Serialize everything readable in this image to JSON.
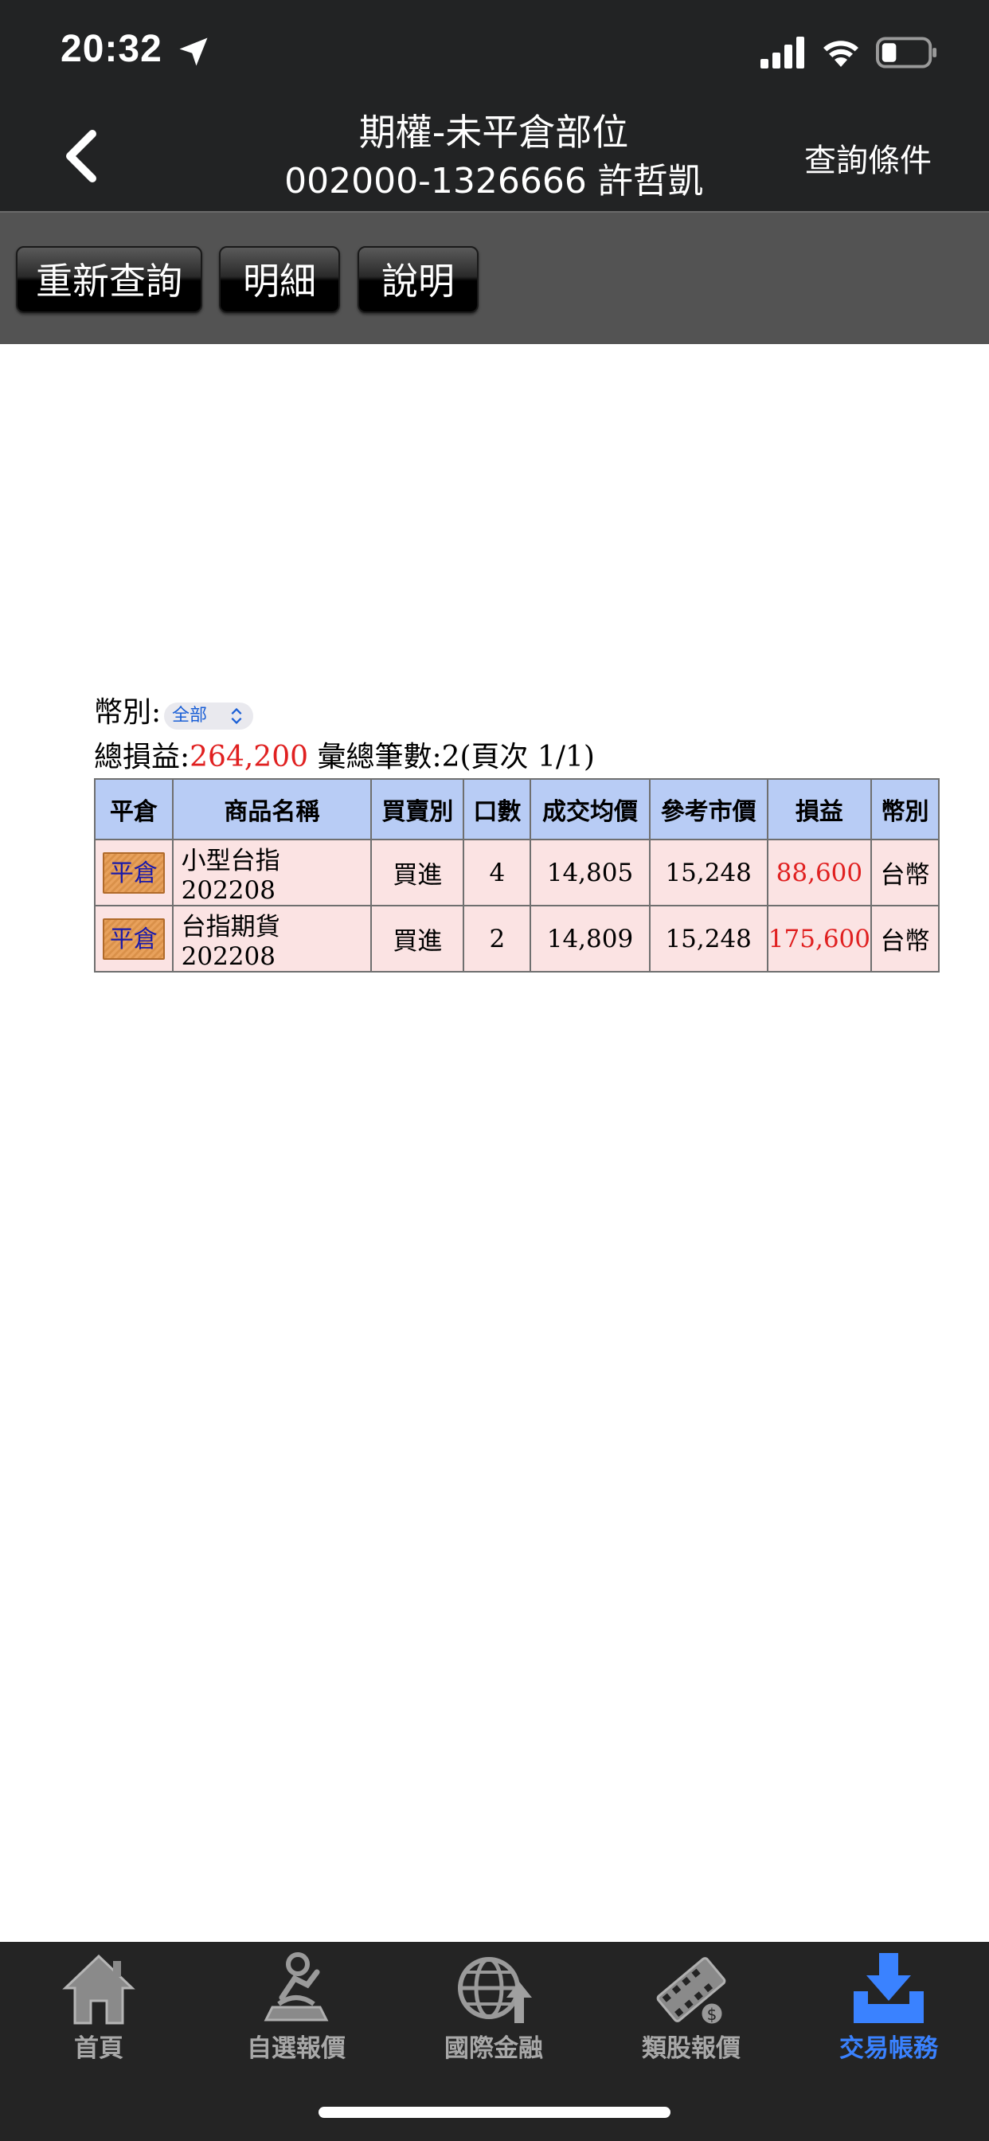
{
  "status_bar": {
    "time": "20:32"
  },
  "nav": {
    "title": "期權-未平倉部位",
    "subtitle": "002000-1326666 許哲凱",
    "right_action": "查詢條件"
  },
  "toolbar": {
    "requery_label": "重新查詢",
    "detail_label": "明細",
    "help_label": "說明"
  },
  "filter": {
    "currency_label": "幣別:",
    "currency_selected": "全部"
  },
  "summary": {
    "total_pl_label": "總損益:",
    "total_pl_value": "264,200",
    "count_text": "彙總筆數:2(頁次 1/1)"
  },
  "table": {
    "headers": [
      "平倉",
      "商品名稱",
      "買賣別",
      "口數",
      "成交均價",
      "參考市價",
      "損益",
      "幣別"
    ],
    "rows": [
      {
        "action": "平倉",
        "name": "小型台指 202208",
        "side": "買進",
        "qty": "4",
        "avg_price": "14,805",
        "ref_price": "15,248",
        "pl": "88,600",
        "currency": "台幣"
      },
      {
        "action": "平倉",
        "name": "台指期貨 202208",
        "side": "買進",
        "qty": "2",
        "avg_price": "14,809",
        "ref_price": "15,248",
        "pl": "175,600",
        "currency": "台幣"
      }
    ]
  },
  "tabbar": {
    "items": [
      {
        "label": "首頁",
        "icon": "house-icon"
      },
      {
        "label": "自選報價",
        "icon": "person-desk-icon"
      },
      {
        "label": "國際金融",
        "icon": "globe-up-icon"
      },
      {
        "label": "類股報價",
        "icon": "film-coin-icon"
      },
      {
        "label": "交易帳務",
        "icon": "download-tray-icon"
      }
    ],
    "active_index": 4
  },
  "colors": {
    "accent": "#3a82ff",
    "profit": "#e02020",
    "header_bg": "#b8ccf5",
    "row_bg": "#fbe3e3"
  }
}
